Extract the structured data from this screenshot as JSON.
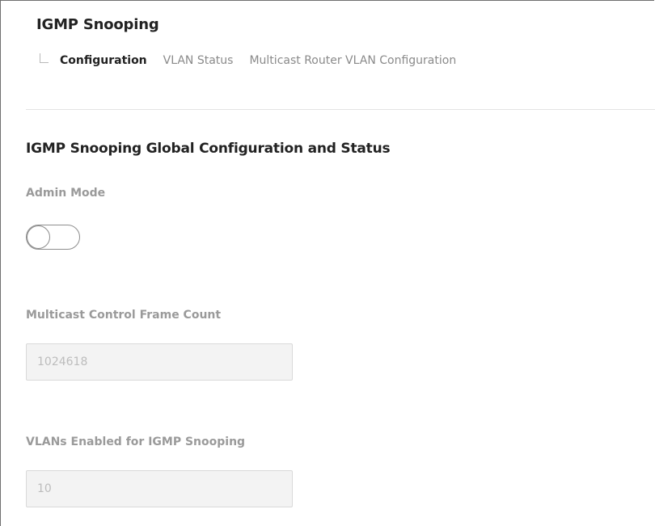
{
  "header": {
    "title": "IGMP Snooping"
  },
  "tabs": [
    {
      "label": "Configuration",
      "active": true
    },
    {
      "label": "VLAN Status",
      "active": false
    },
    {
      "label": "Multicast Router VLAN Configuration",
      "active": false
    }
  ],
  "section": {
    "title": "IGMP Snooping Global Configuration and Status"
  },
  "admin_mode": {
    "label": "Admin Mode",
    "enabled": false
  },
  "frame_count": {
    "label": "Multicast Control Frame Count",
    "value": "1024618"
  },
  "vlans_enabled": {
    "label": "VLANs Enabled for IGMP Snooping",
    "value": "10"
  },
  "colors": {
    "active_tab": "#222222",
    "inactive_tab": "#8a8a8a",
    "label": "#9a9a9a",
    "readonly_bg": "#f3f3f3"
  }
}
